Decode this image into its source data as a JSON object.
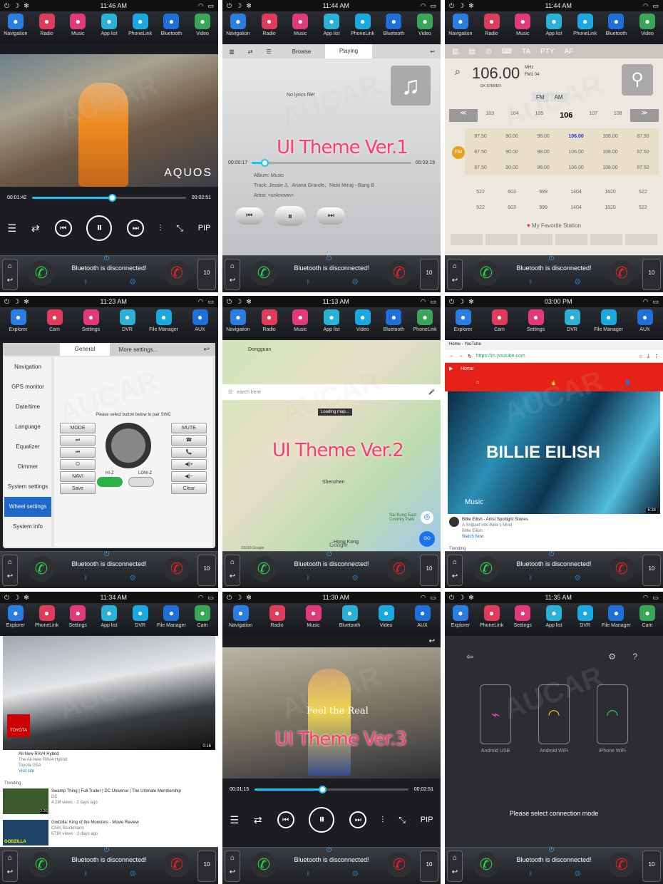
{
  "bt_status": "Bluetooth is disconnected!",
  "vol": "10",
  "watermark": "AUCAR",
  "cells": [
    {
      "time": "11:46 AM",
      "apps": [
        "Navigation",
        "Radio",
        "Music",
        "App list",
        "PhoneLink",
        "Bluetooth",
        "Video"
      ],
      "elapsed": "00:01:42",
      "total": "00:02:51",
      "progress": 0.52,
      "overlay": "AQUOS",
      "pip": "PIP"
    },
    {
      "time": "11:44 AM",
      "apps": [
        "Navigation",
        "Radio",
        "Music",
        "App list",
        "PhoneLink",
        "Bluetooth",
        "Video"
      ],
      "tabs": [
        "Browse",
        "Playing"
      ],
      "lyrics": "No lyrics file!",
      "theme": "UI Theme Ver.1",
      "elapsed": "00:00:17",
      "total": "00:03:19",
      "progress": 0.08,
      "album_label": "Album:",
      "album": "Music",
      "track_label": "Track:",
      "track": "Jessie J、Ariana Grande、Nicki Minaj - Bang B",
      "artist_label": "Artist:",
      "artist": "<unknown>"
    },
    {
      "time": "11:44 AM",
      "apps": [
        "Navigation",
        "Radio",
        "Music",
        "App list",
        "PhoneLink",
        "Bluetooth",
        "Video"
      ],
      "topicons": [
        "TA",
        "PTY",
        "AF"
      ],
      "freq": "106.00",
      "unit": "MHz",
      "band": "FM1  04",
      "stereo": "DX  STEREO",
      "modes": [
        "FM",
        "AM"
      ],
      "dial": [
        "103",
        "104",
        "105",
        "106",
        "107",
        "108"
      ],
      "fm_badge": "FM",
      "presets": [
        [
          "87.50",
          "90.00",
          "98.00",
          "106.00",
          "108.00",
          "87.50"
        ],
        [
          "87.50",
          "90.00",
          "98.00",
          "106.00",
          "108.00",
          "87.50"
        ],
        [
          "87.50",
          "90.00",
          "98.00",
          "106.00",
          "108.00",
          "87.50"
        ]
      ],
      "am": [
        [
          "522",
          "603",
          "999",
          "1404",
          "1620",
          "522"
        ],
        [
          "522",
          "603",
          "999",
          "1404",
          "1620",
          "522"
        ]
      ],
      "favorite": "My Favorite Station"
    },
    {
      "time": "11:23 AM",
      "apps": [
        "Explorer",
        "Cam",
        "Settings",
        "DVR",
        "File Manager",
        "AUX"
      ],
      "tabs": [
        "General",
        "More settings..."
      ],
      "menu": [
        "Navigation",
        "GPS monitor",
        "Date/time",
        "Language",
        "Equalizer",
        "Dimmer",
        "System settings",
        "Wheel settings",
        "System info"
      ],
      "active_menu": 7,
      "swc_hint": "Please select button below to pair SWC",
      "left_btns": [
        "MODE",
        "⏭",
        "⏮",
        "⏻",
        "NAVI",
        "Save"
      ],
      "right_btns": [
        "MUTE",
        "☎",
        "📞",
        "◀)+",
        "◀)−",
        "Clear"
      ],
      "hiz": "HI-Z",
      "lowz": "LOW-Z"
    },
    {
      "time": "11:13 AM",
      "apps": [
        "Navigation",
        "Radio",
        "Music",
        "App list",
        "Video",
        "Bluetooth",
        "PhoneLink"
      ],
      "search": "earch here",
      "loading": "Loading map...",
      "cities": [
        "Dongguan",
        "Shenzhen",
        "Hong Kong",
        "Sai Kung East Country Park"
      ],
      "theme": "UI Theme Ver.2",
      "brand": "Google",
      "go": "GO",
      "copyright": "©2018 Google"
    },
    {
      "time": "03:00 PM",
      "apps": [
        "Explorer",
        "Cam",
        "Settings",
        "DVR",
        "File Manager",
        "AUX"
      ],
      "tab_title": "Home - YouTube",
      "url": "https://m.youtube.com",
      "yt_home": "Home",
      "banner": "BILLIE EILISH",
      "yt_music": "Music",
      "duration": "6:34",
      "vid_title": "Billie Eilish - Artist Spotlight Stories",
      "vid_sub": "A Snippet into Billie's Mind",
      "vid_channel": "Billie Eilish",
      "vid_cta": "Watch Now",
      "trending": "Trending"
    },
    {
      "time": "11:34 AM",
      "apps": [
        "Explorer",
        "PhoneLink",
        "Settings",
        "App list",
        "DVR",
        "File Manager",
        "Cam"
      ],
      "toyota": "TOYOTA",
      "dur1": "0:16",
      "ad_title": "All-New RAV4 Hybrid",
      "ad_sub": "The All-New RAV4 Hybrid",
      "ad_chan": "Toyota USA",
      "ad_cta": "Visit site",
      "trending": "Trending",
      "t1_title": "Swamp Thing | Full Trailer | DC Universe | The Ultimate Membership",
      "t1_chan": "DC",
      "t1_meta": "4.2M views · 2 days ago",
      "t1_dur": "2:26",
      "t2_title": "Godzilla: King of the Monsters - Movie Review",
      "t2_chan": "Chris Stuckmann",
      "t2_meta": "671K views · 2 days ago",
      "godzilla": "GODZILLA"
    },
    {
      "time": "11:30 AM",
      "apps": [
        "Navigation",
        "Radio",
        "Music",
        "Bluetooth",
        "Video",
        "AUX"
      ],
      "feel": "Feel the Real",
      "theme": "UI Theme Ver.3",
      "elapsed": "00:01:15",
      "total": "00:02:51",
      "progress": 0.44,
      "pip": "PIP"
    },
    {
      "time": "11:35 AM",
      "apps": [
        "Explorer",
        "PhoneLink",
        "Settings",
        "App list",
        "DVR",
        "File Manager",
        "Cam"
      ],
      "modes": [
        "Android USB",
        "Android WiFi",
        "iPhone WiFi"
      ],
      "prompt": "Please select connection mode"
    }
  ],
  "colors": {
    "accent": "#19c6f0",
    "theme_text": "#ff3a6c",
    "call_green": "#2bd14a",
    "call_red": "#e3202a",
    "youtube_red": "#e62117",
    "active_menu": "#1d68c9"
  }
}
